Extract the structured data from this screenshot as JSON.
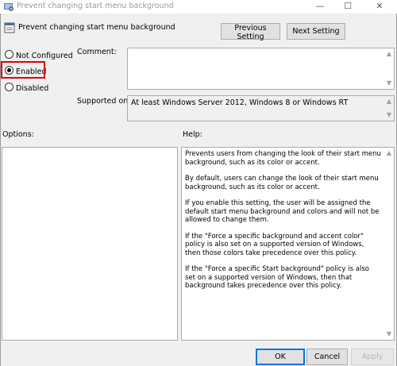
{
  "window": {
    "title": "Prevent changing start menu background",
    "minimize_glyph": "—",
    "maximize_glyph": "☐",
    "close_glyph": "✕"
  },
  "header": {
    "title": "Prevent changing start menu background",
    "previous_button": "Previous Setting",
    "next_button": "Next Setting"
  },
  "state": {
    "options": [
      {
        "label": "Not Configured",
        "checked": false
      },
      {
        "label": "Enabled",
        "checked": true
      },
      {
        "label": "Disabled",
        "checked": false
      }
    ]
  },
  "comment": {
    "label": "Comment:",
    "value": ""
  },
  "supported": {
    "label": "Supported on:",
    "value": "At least Windows Server 2012, Windows 8 or Windows RT"
  },
  "options_section": {
    "label": "Options:"
  },
  "help_section": {
    "label": "Help:",
    "paragraphs": [
      "Prevents users from changing the look of their start menu background, such as its color or accent.",
      "By default, users can change the look of their start menu background, such as its color or accent.",
      "If you enable this setting, the user will be assigned the default start menu background and colors and will not be allowed to change them.",
      "If the \"Force a specific background and accent color\" policy is also set on a supported version of Windows, then those colors take precedence over this policy.",
      "If the \"Force a specific Start background\" policy is also set on a supported version of Windows, then that background takes precedence over this policy."
    ]
  },
  "footer": {
    "ok": "OK",
    "cancel": "Cancel",
    "apply": "Apply"
  },
  "icons": {
    "app": "group-policy-icon",
    "setting": "policy-setting-icon"
  }
}
